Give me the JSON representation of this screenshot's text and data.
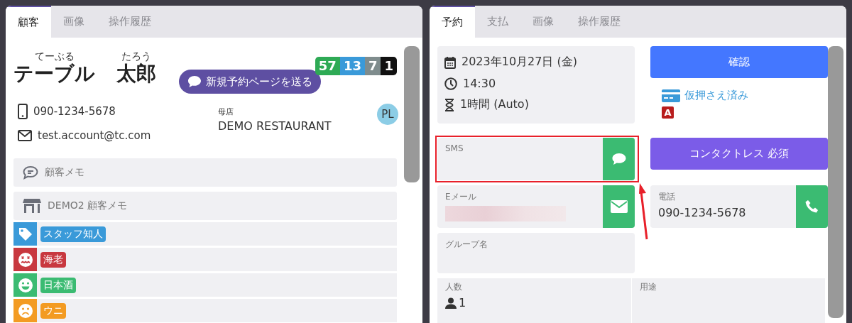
{
  "customer_panel": {
    "tabs": [
      {
        "label": "顧客",
        "selected": true
      },
      {
        "label": "画像",
        "selected": false
      },
      {
        "label": "操作履歴",
        "selected": false
      }
    ],
    "name": [
      {
        "reading": "てーぶる",
        "text": "テーブル"
      },
      {
        "reading": "たろう",
        "text": "太郎"
      }
    ],
    "send_button": "新規予約ページを送る",
    "visit_counts": [
      {
        "value": "57",
        "color": "#2eaa55"
      },
      {
        "value": "13",
        "color": "#3a9ad9"
      },
      {
        "value": "7",
        "color": "#7f8c8d"
      },
      {
        "value": "1",
        "color": "#111111"
      }
    ],
    "phone": "090-1234-5678",
    "email": "test.account@tc.com",
    "home_store_label": "母店",
    "home_store": "DEMO RESTAURANT",
    "avatar": "PL",
    "memos": [
      {
        "kind": "chat",
        "label": "顧客メモ"
      },
      {
        "kind": "store",
        "label": "DEMO2 顧客メモ"
      }
    ],
    "tags": [
      {
        "kind": "tag",
        "label": "スタッフ知人",
        "color": "#3a9ad9"
      },
      {
        "kind": "dizzy",
        "label": "海老",
        "color": "#c8383f"
      },
      {
        "kind": "smile",
        "label": "日本酒",
        "color": "#3bbb72"
      },
      {
        "kind": "frown",
        "label": "ウニ",
        "color": "#f39b22"
      }
    ]
  },
  "reservation_panel": {
    "tabs": [
      {
        "label": "予約",
        "selected": true
      },
      {
        "label": "支払",
        "selected": false
      },
      {
        "label": "画像",
        "selected": false
      },
      {
        "label": "操作履歴",
        "selected": false
      }
    ],
    "date": "2023年10月27日 (金)",
    "time": "14:30",
    "duration": "1時間 (Auto)",
    "confirm_button": "確認",
    "payment_status": "仮押さえ済み",
    "source_badge": "A",
    "sms_label": "SMS",
    "contactless_button": "コンタクトレス 必須",
    "email_label": "Eメール",
    "email_redacted": true,
    "phone_label": "電話",
    "phone_value": "090-1234-5678",
    "group_label": "グループ名",
    "details": [
      {
        "label": "人数",
        "value": "1"
      },
      {
        "label": "用途"
      }
    ]
  }
}
